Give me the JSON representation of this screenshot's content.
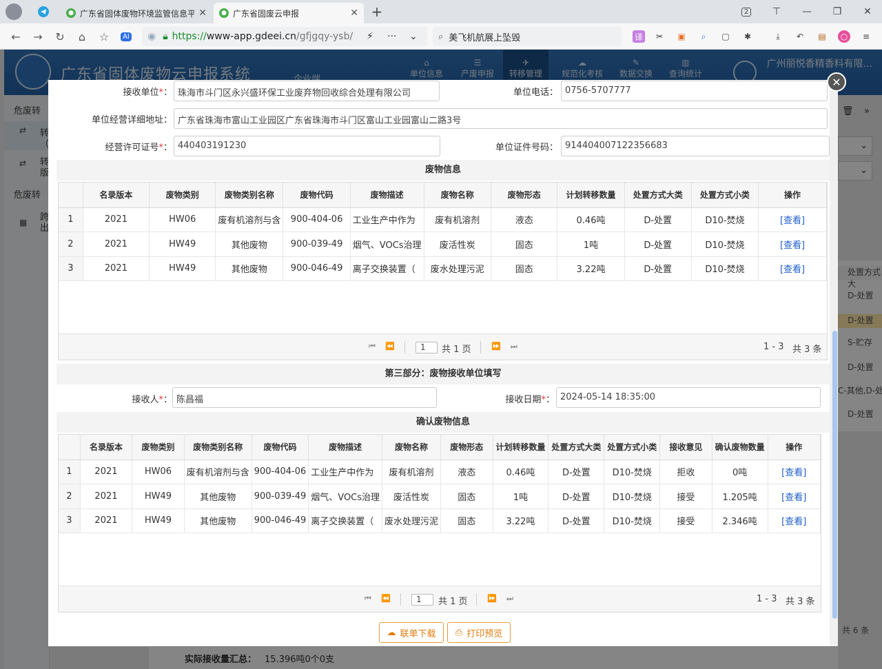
{
  "browser": {
    "tabs": [
      {
        "title": "广东省固体废物环境监管信息平"
      },
      {
        "title": "广东省固废云申报"
      }
    ],
    "tab_count": "2",
    "url_green": "https://",
    "url_domain": "www-app.gdeei.cn",
    "url_path": "/gfjgqy-ysb/",
    "search_text": "美飞机航展上坠毁"
  },
  "site": {
    "title": "广东省固体废物云申报系统",
    "subtitle": "企业端",
    "nav": [
      "单位信息",
      "产废申报",
      "转移管理",
      "规范化考核",
      "数据交换",
      "查询统计"
    ],
    "user_name": "广州丽悦香精香料有限...",
    "sidebar_lines": [
      "危废转",
      "转",
      "（",
      "转",
      "版",
      "危废转",
      "跨",
      "出"
    ],
    "right_fragments": [
      "处置方式大",
      "D-处置",
      "D-处置",
      "S-贮存",
      "D-处置",
      "C-其他,D-处",
      "D-处置",
      "共 6 条"
    ],
    "summary_label": "实际接收量汇总：",
    "summary_value": "15.396吨0个0支"
  },
  "form": {
    "receiver_unit_label": "接收单位",
    "receiver_unit": "珠海市斗门区永兴盛环保工业废弃物回收综合处理有限公司",
    "phone_label": "单位电话",
    "phone": "0756-5707777",
    "address_label": "单位经营详细地址：",
    "address": "广东省珠海市富山工业园区广东省珠海市斗门区富山工业园富山二路3号",
    "license_label": "经营许可证号",
    "license": "440403191230",
    "cert_label": "单位证件号码：",
    "cert": "914404007122356683",
    "req_mark": "*",
    "colon": "："
  },
  "waste_section": {
    "title": "废物信息",
    "headers": [
      "名录版本",
      "废物类别",
      "废物类别名称",
      "废物代码",
      "废物描述",
      "废物名称",
      "废物形态",
      "计划转移数量",
      "处置方式大类",
      "处置方式小类",
      "操作"
    ],
    "rows": [
      {
        "no": "1",
        "version": "2021",
        "category": "HW06",
        "category_name": "废有机溶剂与含",
        "code": "900-404-06",
        "desc": "工业生产中作为",
        "name": "废有机溶剂",
        "form": "液态",
        "planned": "0.46吨",
        "method_major": "D-处置",
        "method_minor": "D10-焚烧",
        "op": "[查看]"
      },
      {
        "no": "2",
        "version": "2021",
        "category": "HW49",
        "category_name": "其他废物",
        "code": "900-039-49",
        "desc": "烟气、VOCs治理",
        "name": "废活性炭",
        "form": "固态",
        "planned": "1吨",
        "method_major": "D-处置",
        "method_minor": "D10-焚烧",
        "op": "[查看]"
      },
      {
        "no": "3",
        "version": "2021",
        "category": "HW49",
        "category_name": "其他废物",
        "code": "900-046-49",
        "desc": "离子交换装置（",
        "name": "废水处理污泥",
        "form": "固态",
        "planned": "3.22吨",
        "method_major": "D-处置",
        "method_minor": "D10-焚烧",
        "op": "[查看]"
      }
    ],
    "pager": {
      "page": "1",
      "total_pages": "共 1 页",
      "range": "1 - 3",
      "total": "共 3 条"
    }
  },
  "part3": {
    "title": "第三部分：废物接收单位填写",
    "receiver_label": "接收人",
    "receiver": "陈昌福",
    "date_label": "接收日期",
    "date": "2024-05-14 18:35:00"
  },
  "confirm_section": {
    "title": "确认废物信息",
    "headers": [
      "名录版本",
      "废物类别",
      "废物类别名称",
      "废物代码",
      "废物描述",
      "废物名称",
      "废物形态",
      "计划转移数量",
      "处置方式大类",
      "处置方式小类",
      "接收意见",
      "确认废物数量",
      "操作"
    ],
    "rows": [
      {
        "no": "1",
        "version": "2021",
        "category": "HW06",
        "category_name": "废有机溶剂与含",
        "code": "900-404-06",
        "desc": "工业生产中作为",
        "name": "废有机溶剂",
        "form": "液态",
        "planned": "0.46吨",
        "method_major": "D-处置",
        "method_minor": "D10-焚烧",
        "opinion": "拒收",
        "confirmed": "0吨",
        "op": "[查看]"
      },
      {
        "no": "2",
        "version": "2021",
        "category": "HW49",
        "category_name": "其他废物",
        "code": "900-039-49",
        "desc": "烟气、VOCs治理",
        "name": "废活性炭",
        "form": "固态",
        "planned": "1吨",
        "method_major": "D-处置",
        "method_minor": "D10-焚烧",
        "opinion": "接受",
        "confirmed": "1.205吨",
        "op": "[查看]"
      },
      {
        "no": "3",
        "version": "2021",
        "category": "HW49",
        "category_name": "其他废物",
        "code": "900-046-49",
        "desc": "离子交换装置（",
        "name": "废水处理污泥",
        "form": "固态",
        "planned": "3.22吨",
        "method_major": "D-处置",
        "method_minor": "D10-焚烧",
        "opinion": "接受",
        "confirmed": "2.346吨",
        "op": "[查看]"
      }
    ],
    "pager": {
      "page": "1",
      "total_pages": "共 1 页",
      "range": "1 - 3",
      "total": "共 3 条"
    }
  },
  "actions": {
    "download_label": "联单下载",
    "print_label": "打印预览"
  }
}
